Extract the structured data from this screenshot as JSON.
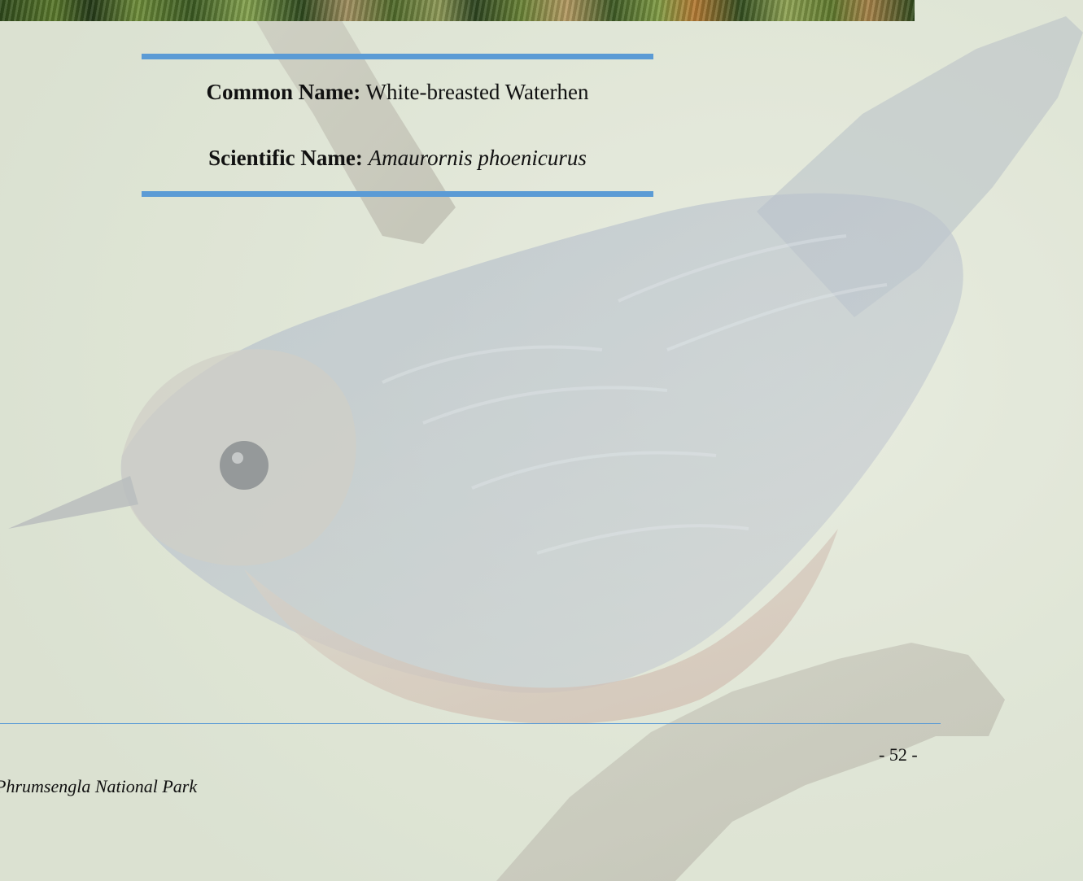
{
  "header": {
    "common_name_label": "Common Name:",
    "common_name_value": "White-breasted Waterhen",
    "scientific_name_label": "Scientific Name:",
    "scientific_name_value": "Amaurornis phoenicurus"
  },
  "footer": {
    "page_number": "- 52 -",
    "park_name": "Phrumsengla National Park"
  },
  "colors": {
    "accent_rule": "#5b9bd5"
  }
}
